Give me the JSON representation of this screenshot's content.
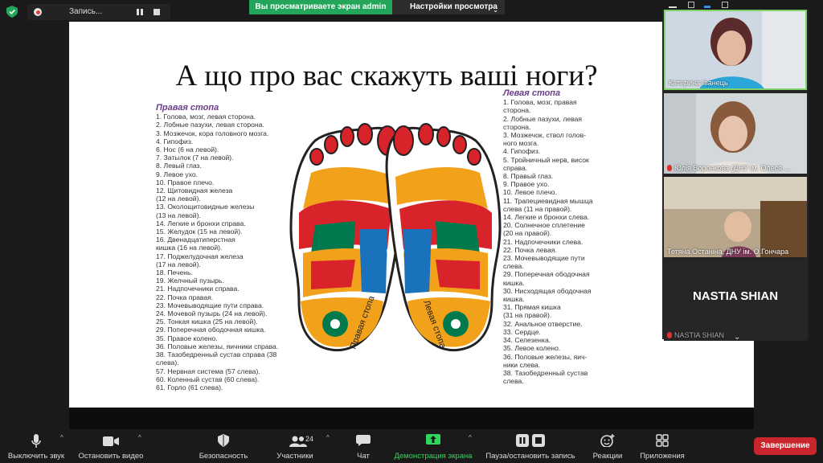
{
  "topbar": {
    "recording_label": "Запись...",
    "viewing_banner": "Вы просматриваете экран admin",
    "view_options": "Настройки просмотра"
  },
  "slide": {
    "title": "А що про вас скажуть ваші ноги?",
    "right_foot_heading": "Правая стопа",
    "left_foot_heading": "Левая стопа",
    "right_foot_caption": "Правая стопа",
    "left_foot_caption": "Левая стопа",
    "right_list": [
      "1. Голова, мозг, левая сторона.",
      "2. Лобные пазухи, левая сторона.",
      "3. Мозжечок, кора головного мозга.",
      "4. Гипофиз.",
      "6. Нос (6 на левой).",
      "7. Затылок (7 на левой).",
      "8. Левый глаз.",
      "9. Левое ухо.",
      "10. Правое плечо.",
      "12. Щитовидная железа",
      "(12 на левой).",
      "13. Околощитовидные железы",
      "(13 на левой).",
      "14. Легкие и бронхи справа.",
      "15. Желудок (15 на левой).",
      "16. Двенадцатиперстная",
      "кишка (16 на левой).",
      "17. Поджелудочная железа",
      "(17 на левой).",
      "18. Печень.",
      "19. Желчный пузырь.",
      "21. Надпочечники справа.",
      "22. Почка правая.",
      "23. Мочевыводящие пути справа.",
      "24. Мочевой пузырь (24 на левой).",
      "25. Тонкая кишка (25 на левой).",
      "29. Поперечная ободочная кишка.",
      "35. Правое колено.",
      "36. Половые железы, яичники справа.",
      "38. Тазобедренный сустав справа (38 слева).",
      "57. Нервная система (57 слева).",
      "60. Коленный сустав (60 слева).",
      "61. Горло (61 слева)."
    ],
    "left_list": [
      "1. Голова, мозг, правая",
      "сторона.",
      "2. Лобные пазухи, левая",
      "сторона.",
      "3. Мозжечок, ствол голов-",
      "ного мозга.",
      "4. Гипофиз.",
      "5. Тройничный нерв, висок",
      "справа.",
      "8. Правый глаз.",
      "9. Правое ухо.",
      "10. Левое плечо.",
      "11. Трапециевидная мышца",
      "слева (11 на правой).",
      "14. Легкие и бронхи слева.",
      "20. Солнечное сплетение",
      "(20 на правой).",
      "21. Надпочечники слева.",
      "22. Почка левая.",
      "23. Мочевыводящие пути",
      "слева.",
      "29. Поперечная ободочная",
      "кишка.",
      "30. Нисходящая ободочная",
      "кишка.",
      "31. Прямая кишка",
      "(31 на правой).",
      "32. Анальное отверстие.",
      "33. Сердце.",
      "34. Селезенка.",
      "35. Левое колено.",
      "36. Половые железы, яич-",
      "ники слева.",
      "38. Тазобедренный сустав",
      "слева."
    ]
  },
  "participants": [
    {
      "name": "Катерина Іванець",
      "muted": false
    },
    {
      "name": "Юлія Воронкова (ДНУ ім. Олеся ...",
      "muted": true
    },
    {
      "name": "Тетяна Останіна, ДНУ ім. О.Гончара",
      "muted": false
    },
    {
      "name": "NASTIA SHIAN",
      "display": "NASTIA SHIAN",
      "muted": true
    }
  ],
  "toolbar": {
    "mute": "Выключить звук",
    "video": "Остановить видео",
    "security": "Безопасность",
    "participants": "Участники",
    "participants_count": "24",
    "chat": "Чат",
    "share": "Демонстрация экрана",
    "record": "Пауза/остановить запись",
    "reactions": "Реакции",
    "apps": "Приложения",
    "end": "Завершение"
  },
  "colors": {
    "accent_green": "#23a55a",
    "end_red": "#c8252c",
    "heading_purple": "#6b3d8c"
  }
}
